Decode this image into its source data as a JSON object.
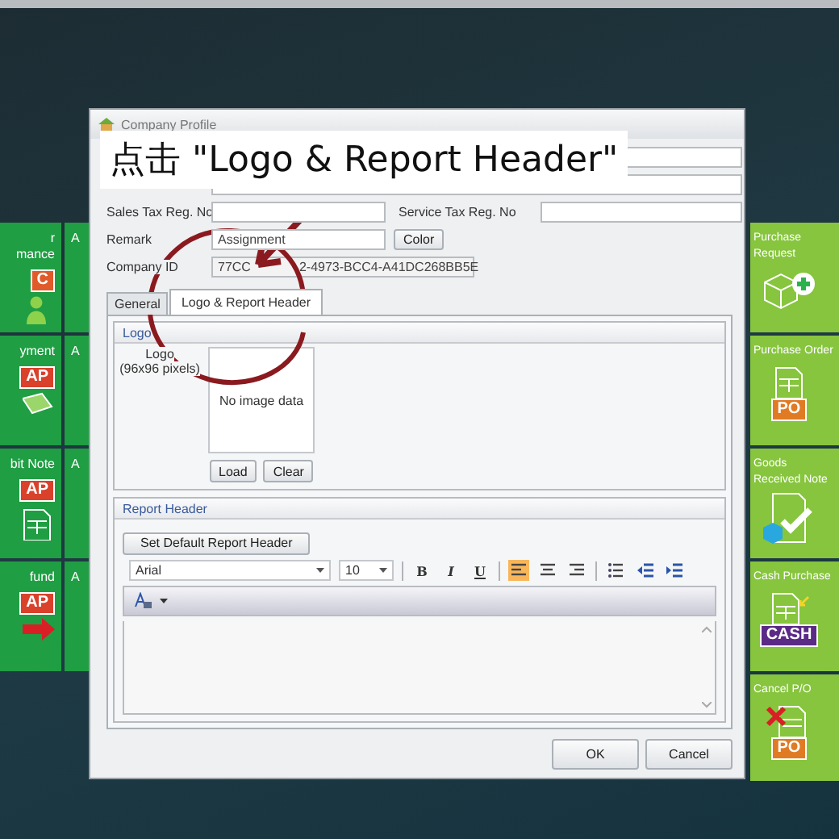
{
  "caption": "点击 \"Logo & Report Header\"",
  "left_tiles": [
    {
      "lines": [
        "r",
        "mance"
      ],
      "badge": "C",
      "kind": "person"
    },
    {
      "lines": [
        "yment"
      ],
      "badge": "AP",
      "kind": "money"
    },
    {
      "lines": [
        "bit Note"
      ],
      "badge": "AP",
      "kind": "doc"
    },
    {
      "lines": [
        "fund"
      ],
      "badge": "AP",
      "kind": "refund"
    }
  ],
  "second_column_tiles": [
    "A",
    "A",
    "A",
    "A"
  ],
  "right_tiles": [
    {
      "lines": [
        "Purchase",
        "Request"
      ],
      "kind": "add"
    },
    {
      "lines": [
        "Purchase Order"
      ],
      "badge": "PO",
      "kind": "doc"
    },
    {
      "lines": [
        "Goods",
        "Received Note"
      ],
      "kind": "check"
    },
    {
      "lines": [
        "Cash Purchase"
      ],
      "badge": "CASH",
      "kind": "cash"
    },
    {
      "lines": [
        "Cancel P/O"
      ],
      "badge": "PO",
      "kind": "cancel"
    }
  ],
  "dialog": {
    "title": "Company Profile",
    "rows": [
      {
        "items": [
          {
            "kind": "wide_input"
          }
        ]
      },
      {
        "items": [
          {
            "kind": "wide_input"
          }
        ]
      },
      {
        "label": "Sales Tax Reg. No",
        "items": [
          {
            "kind": "input"
          },
          {
            "kind": "text",
            "text": "Service Tax Reg. No"
          },
          {
            "kind": "input"
          }
        ]
      },
      {
        "label": "Remark",
        "items": [
          {
            "kind": "input",
            "value": "Assignment"
          },
          {
            "kind": "button",
            "text": "Color"
          }
        ]
      },
      {
        "label": "Company ID",
        "items": [
          {
            "kind": "id",
            "parts": [
              "77CC",
              "2-4973-BCC4-A41DC268BB5E"
            ]
          }
        ]
      }
    ],
    "tabs": [
      {
        "label": "General",
        "selected": false
      },
      {
        "label": "Logo & Report Header",
        "selected": true
      }
    ],
    "logo_group": {
      "title": "Logo",
      "label": "Logo",
      "hint": "(96x96 pixels)",
      "image_text": "No image data",
      "buttons": [
        "Load",
        "Clear"
      ]
    },
    "report_group": {
      "title": "Report Header",
      "default_button": "Set Default Report Header",
      "font": "Arial",
      "size": "10",
      "tools": [
        {
          "kind": "bold",
          "label": "B",
          "selected": false
        },
        {
          "kind": "italic",
          "label": "I",
          "selected": false
        },
        {
          "kind": "underline",
          "label": "U",
          "selected": false
        },
        {
          "kind": "align_left",
          "selected": true
        },
        {
          "kind": "align_center",
          "selected": false
        },
        {
          "kind": "align_right",
          "selected": false
        },
        {
          "kind": "bullets",
          "selected": false
        },
        {
          "kind": "outdent",
          "selected": false
        },
        {
          "kind": "indent",
          "selected": false
        }
      ]
    },
    "buttons": [
      "OK",
      "Cancel"
    ]
  }
}
